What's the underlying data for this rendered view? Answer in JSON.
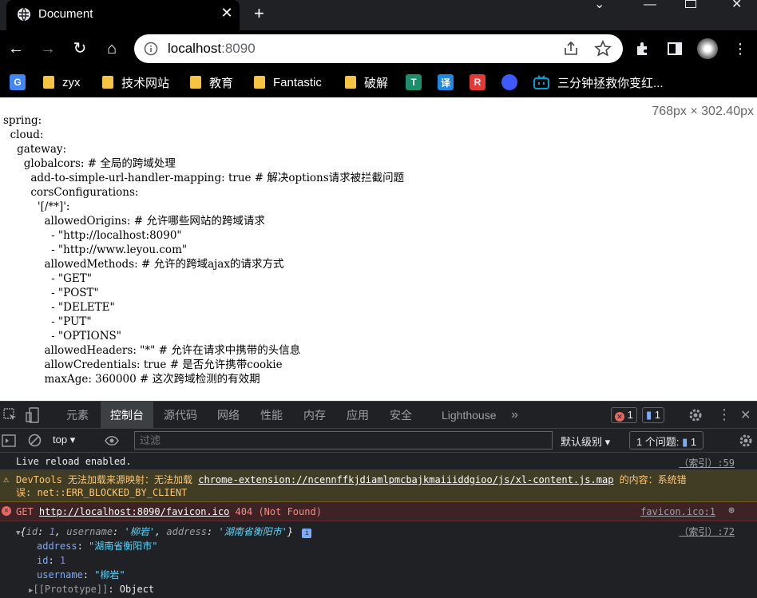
{
  "browser": {
    "tab_title": "Document",
    "url_host": "localhost",
    "url_port": ":8090"
  },
  "bookmarks": [
    {
      "label": "zyx"
    },
    {
      "label": "技术网站"
    },
    {
      "label": "教育"
    },
    {
      "label": "Fantastic"
    },
    {
      "label": "破解"
    },
    {
      "label": "三分钟拯救你变红..."
    }
  ],
  "bookmark_icons": [
    {
      "glyph": "T",
      "color": "#1a8f6b"
    },
    {
      "glyph": "译",
      "color": "#1e88e5"
    },
    {
      "glyph": "R",
      "color": "#e53935"
    },
    {
      "glyph": "",
      "color": "#3d5afe"
    }
  ],
  "page": {
    "size_label": "768px × 302.40px",
    "yaml_lines": [
      "spring:",
      "  cloud:",
      "    gateway:",
      "      globalcors: # 全局的跨域处理",
      "        add-to-simple-url-handler-mapping: true # 解决options请求被拦截问题",
      "        corsConfigurations:",
      "          '[/**]':",
      "            allowedOrigins: # 允许哪些网站的跨域请求",
      "              - \"http://localhost:8090\"",
      "              - \"http://www.leyou.com\"",
      "            allowedMethods: # 允许的跨域ajax的请求方式",
      "              - \"GET\"",
      "              - \"POST\"",
      "              - \"DELETE\"",
      "              - \"PUT\"",
      "              - \"OPTIONS\"",
      "            allowedHeaders: \"*\" # 允许在请求中携带的头信息",
      "            allowCredentials: true # 是否允许携带cookie",
      "            maxAge: 360000 # 这次跨域检测的有效期"
    ]
  },
  "devtools": {
    "tabs": [
      "元素",
      "控制台",
      "源代码",
      "网络",
      "性能",
      "内存",
      "应用",
      "安全",
      "Lighthouse"
    ],
    "more_tabs": "»",
    "error_count": "1",
    "message_count": "1",
    "context": "top",
    "filter_placeholder": "过滤",
    "level": "默认级别",
    "issues_label": "1 个问题:",
    "issues_count": "1",
    "console": {
      "log_text": "Live reload enabled.",
      "log_src": "（索引）:59",
      "warn_prefix": "DevTools 无法加载来源映射：无法加载 ",
      "warn_link": "chrome-extension://ncennffkjdiamlpmcbajkmaiiiddgioo/js/xl-content.js.map",
      "warn_suffix": " 的内容：系统错",
      "warn_line2": "误: net::ERR_BLOCKED_BY_CLIENT",
      "err_method": "GET ",
      "err_url": "http://localhost:8090/favicon.ico",
      "err_status": " 404 (Not Found)",
      "err_src": "favicon.ico:1",
      "obj_src": "（索引）:72",
      "obj_summary_open": "{",
      "obj_k1": "id",
      "obj_v1": "1",
      "obj_k2": "username",
      "obj_v2": "'柳岩'",
      "obj_k3": "address",
      "obj_v3": "'湖南省衡阳市'",
      "obj_summary_close": "}",
      "prop_address_key": "address",
      "prop_address_val": "\"湖南省衡阳市\"",
      "prop_id_key": "id",
      "prop_id_val": "1",
      "prop_username_key": "username",
      "prop_username_val": "\"柳岩\"",
      "prototype_key": "[[Prototype]]",
      "prototype_val": "Object"
    }
  }
}
